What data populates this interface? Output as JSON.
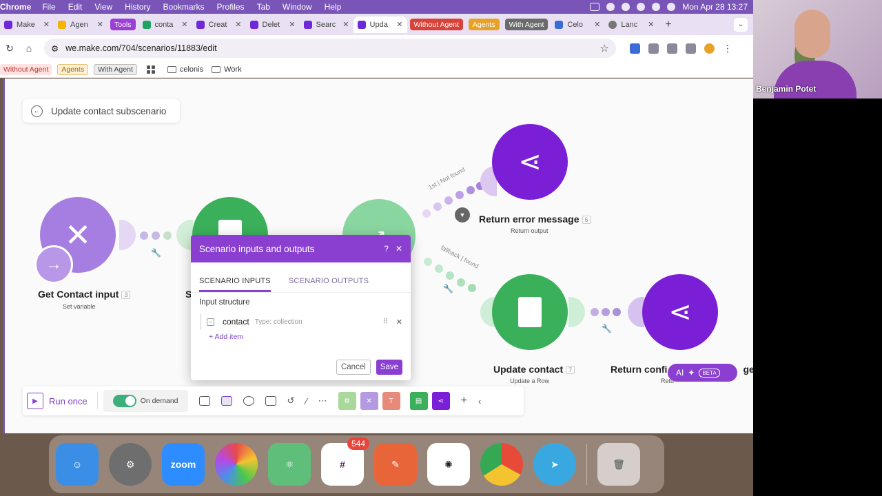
{
  "menubar": {
    "app_name": "Chrome",
    "items": [
      "File",
      "Edit",
      "View",
      "History",
      "Bookmarks",
      "Profiles",
      "Tab",
      "Window",
      "Help"
    ],
    "clock": "Mon Apr 28  13:27"
  },
  "tabs": [
    {
      "label": "Make",
      "color": "#6d28d9"
    },
    {
      "label": "Agen",
      "color": "#f4b400"
    },
    {
      "label": "Tools",
      "pill": true,
      "color": "#9b3fd6"
    },
    {
      "label": "conta",
      "color": "#1ea362"
    },
    {
      "label": "Creat",
      "color": "#6d28d9"
    },
    {
      "label": "Delet",
      "color": "#6d28d9"
    },
    {
      "label": "Searc",
      "color": "#6d28d9"
    },
    {
      "label": "Upda",
      "color": "#6d28d9",
      "active": true
    },
    {
      "label": "Without Agent",
      "pill": true,
      "color": "#d9423a"
    },
    {
      "label": "Agents",
      "pill": true,
      "color": "#e8a227"
    },
    {
      "label": "With Agent",
      "pill": true,
      "color": "#6b6b6b"
    },
    {
      "label": "Celo",
      "color": "#3b6bd6"
    },
    {
      "label": "Lanc",
      "color": "#777777"
    }
  ],
  "address": {
    "url": "we.make.com/704/scenarios/11883/edit"
  },
  "bookmarks": {
    "pills": [
      {
        "label": "Without Agent",
        "bg": "#fde2e1",
        "fg": "#c0392b"
      },
      {
        "label": "Agents",
        "bg": "#fdf0d6",
        "fg": "#a06a00"
      },
      {
        "label": "With Agent",
        "bg": "#ececec",
        "fg": "#444444"
      }
    ],
    "folders": [
      "celonis",
      "Work"
    ]
  },
  "canvas": {
    "breadcrumb": "Update contact subscenario",
    "nodes": {
      "get_contact": {
        "title": "Get Contact input",
        "num": "3",
        "sub": "Set variable"
      },
      "search": {
        "title": "Se"
      },
      "return_error": {
        "title": "Return error message",
        "num": "6",
        "sub": "Return output"
      },
      "update_contact": {
        "title": "Update contact",
        "num": "7",
        "sub": "Update a Row"
      },
      "return_confirm": {
        "title": "Return confi",
        "suffix": "ge",
        "sub": "Retu"
      }
    },
    "routes": {
      "route1": "1st | Not found",
      "route2": "fallback | found"
    }
  },
  "modal": {
    "title": "Scenario inputs and outputs",
    "help": "?",
    "close": "✕",
    "tabs": [
      "SCENARIO INPUTS",
      "SCENARIO OUTPUTS"
    ],
    "structure_label": "Input structure",
    "item": {
      "name": "contact",
      "type": "Type: collection"
    },
    "add_item": "+  Add item",
    "cancel": "Cancel",
    "save": "Save"
  },
  "toolbar": {
    "run_label": "Run once",
    "schedule_label": "On demand"
  },
  "ai_pill": {
    "label": "AI",
    "badge": "BETA"
  },
  "video": {
    "name": "Benjamin Potet"
  },
  "dock": {
    "apps": [
      {
        "name": "finder",
        "color": "#3a8ee6"
      },
      {
        "name": "settings",
        "color": "#6e6e6e"
      },
      {
        "name": "zoom",
        "label": "zoom",
        "color": "#2d8cff"
      },
      {
        "name": "color",
        "color": "#d94aa0"
      },
      {
        "name": "atom",
        "color": "#5fbf7a"
      },
      {
        "name": "slack",
        "color": "#ffffff",
        "badge": "544"
      },
      {
        "name": "pen",
        "color": "#e8653a"
      },
      {
        "name": "chatgpt",
        "color": "#ffffff"
      },
      {
        "name": "chrome",
        "color": "#e6e6e6"
      },
      {
        "name": "telegram",
        "color": "#3aa8e0"
      }
    ]
  }
}
